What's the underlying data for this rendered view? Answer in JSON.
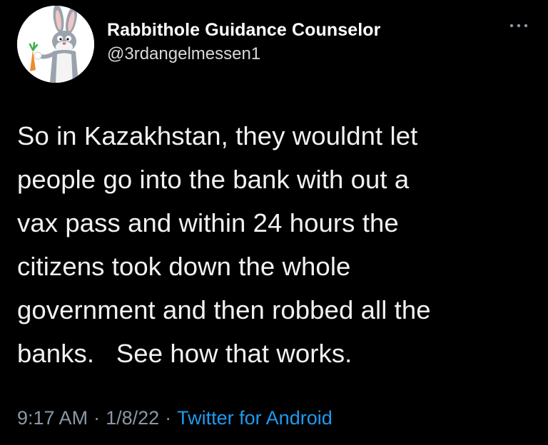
{
  "tweet": {
    "author": {
      "display_name": "Rabbithole Guidance Counselor",
      "handle": "@3rdangelmessen1",
      "avatar_icon": "bugs-bunny-avatar"
    },
    "more_icon": "more-horizontal-icon",
    "text": "So in Kazakhstan, they wouldnt let\npeople go into the bank with out a\nvax pass and within 24 hours the\ncitizens took down the whole\ngovernment and then robbed all the\nbanks.   See how that works.",
    "time": "9:17 AM",
    "separator": "·",
    "date": "1/8/22",
    "source": "Twitter for Android"
  },
  "colors": {
    "background": "#000000",
    "text": "#f2f2f2",
    "meta": "#8b98a5",
    "link": "#1d9bf0"
  }
}
